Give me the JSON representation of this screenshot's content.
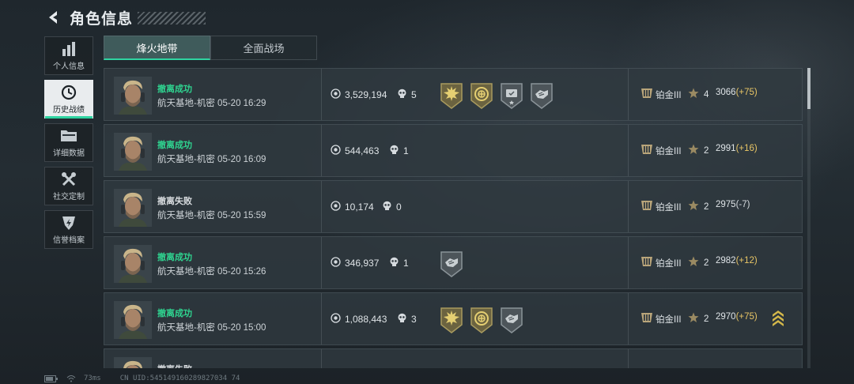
{
  "header": {
    "title": "角色信息"
  },
  "sidebar": {
    "items": [
      {
        "label": "个人信息",
        "icon": "bar-chart-icon"
      },
      {
        "label": "历史战绩",
        "icon": "clock-icon",
        "active": true
      },
      {
        "label": "详细数据",
        "icon": "folder-icon"
      },
      {
        "label": "社交定制",
        "icon": "tools-icon"
      },
      {
        "label": "信誉档案",
        "icon": "shield-icon"
      }
    ]
  },
  "tabs": [
    {
      "label": "烽火地带",
      "active": true
    },
    {
      "label": "全面战场",
      "active": false
    }
  ],
  "matches": [
    {
      "status": "撤离成功",
      "result": "success",
      "map": "航天基地-机密",
      "time": "05-20 16:29",
      "money": "3,529,194",
      "kills": "5",
      "badges": [
        "sun-medal",
        "target-medal",
        "camera-medal",
        "armor-medal"
      ],
      "rank": "铂金III",
      "stars": "4",
      "score": "3066",
      "delta": "(+75)",
      "delta_sign": "pos",
      "streak": false
    },
    {
      "status": "撤离成功",
      "result": "success",
      "map": "航天基地-机密",
      "time": "05-20 16:09",
      "money": "544,463",
      "kills": "1",
      "badges": [],
      "rank": "铂金III",
      "stars": "2",
      "score": "2991",
      "delta": "(+16)",
      "delta_sign": "pos",
      "streak": false
    },
    {
      "status": "撤离失败",
      "result": "fail",
      "map": "航天基地-机密",
      "time": "05-20 15:59",
      "money": "10,174",
      "kills": "0",
      "badges": [],
      "rank": "铂金III",
      "stars": "2",
      "score": "2975",
      "delta": "(-7)",
      "delta_sign": "neg",
      "streak": false
    },
    {
      "status": "撤离成功",
      "result": "success",
      "map": "航天基地-机密",
      "time": "05-20 15:26",
      "money": "346,937",
      "kills": "1",
      "badges": [
        "armor-medal"
      ],
      "rank": "铂金III",
      "stars": "2",
      "score": "2982",
      "delta": "(+12)",
      "delta_sign": "pos",
      "streak": false
    },
    {
      "status": "撤离成功",
      "result": "success",
      "map": "航天基地-机密",
      "time": "05-20 15:00",
      "money": "1,088,443",
      "kills": "3",
      "badges": [
        "sun-medal",
        "target-medal",
        "armor-medal"
      ],
      "rank": "铂金III",
      "stars": "2",
      "score": "2970",
      "delta": "(+75)",
      "delta_sign": "pos",
      "streak": true
    },
    {
      "status": "撤离失败",
      "result": "fail",
      "map": "",
      "time": "",
      "money": "",
      "kills": "",
      "badges": [],
      "rank": "",
      "stars": "",
      "score": "",
      "delta": "",
      "delta_sign": "neg",
      "streak": false
    }
  ],
  "footer": {
    "ping": "73ms",
    "uid": "CN UID:545149160289827034 74"
  },
  "colors": {
    "accent": "#2fd4a1",
    "success": "#2fd490",
    "gold": "#e8c565"
  }
}
